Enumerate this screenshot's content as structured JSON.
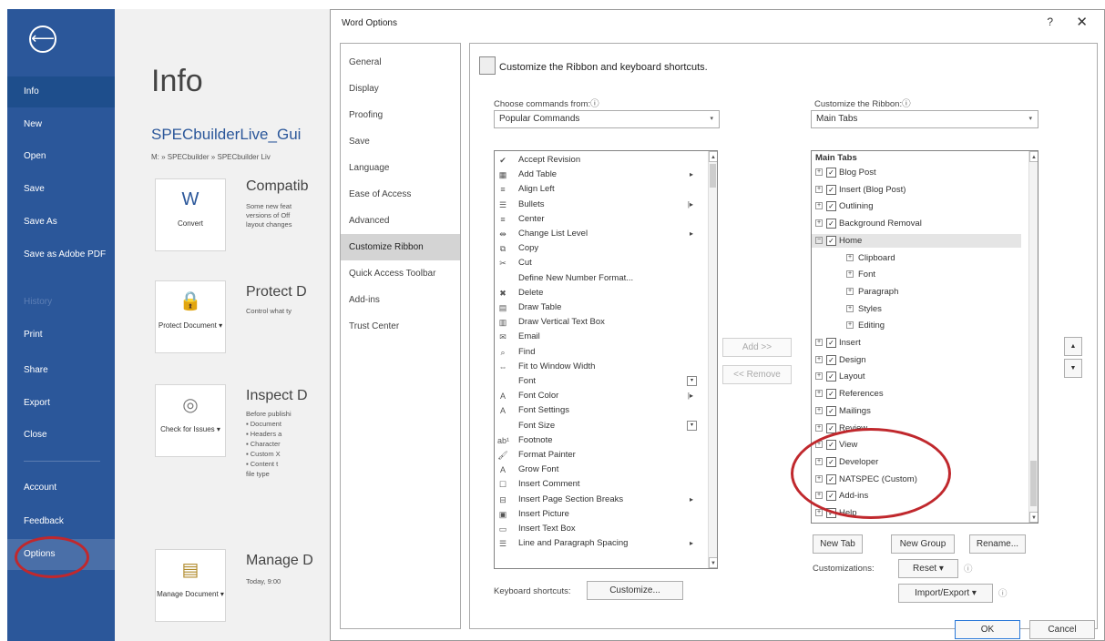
{
  "nav": {
    "back": "⟵",
    "items": [
      {
        "label": "Info"
      },
      {
        "label": "New"
      },
      {
        "label": "Open"
      },
      {
        "label": "Save"
      },
      {
        "label": "Save As"
      },
      {
        "label": "Save as Adobe PDF"
      },
      {
        "label": "History"
      },
      {
        "label": "Print"
      },
      {
        "label": "Share"
      },
      {
        "label": "Export"
      },
      {
        "label": "Close"
      },
      {
        "label": "Account"
      },
      {
        "label": "Feedback"
      },
      {
        "label": "Options"
      }
    ]
  },
  "info": {
    "title": "Info",
    "filename": "SPECbuilderLive_Gui",
    "path": "M: » SPECbuilder » SPECbuilder Liv",
    "sections": [
      {
        "tile": "Convert",
        "title": "Compatib",
        "lines": [
          "Some new feat",
          "versions of Off",
          "layout changes"
        ]
      },
      {
        "tile": "Protect Document ▾",
        "title": "Protect D",
        "lines": [
          "Control what ty"
        ]
      },
      {
        "tile": "Check for Issues ▾",
        "title": "Inspect D",
        "lines": [
          "Before publishi",
          "▪  Document",
          "▪  Headers a",
          "▪  Character",
          "▪  Custom X",
          "▪  Content t",
          "    file type"
        ]
      },
      {
        "tile": "Manage Document ▾",
        "title": "Manage D",
        "lines": [
          "Today, 9:00"
        ]
      }
    ]
  },
  "dialog": {
    "title": "Word Options",
    "help": "?",
    "close": "✕",
    "categories": [
      "General",
      "Display",
      "Proofing",
      "Save",
      "Language",
      "Ease of Access",
      "Advanced",
      "Customize Ribbon",
      "Quick Access Toolbar",
      "Add-ins",
      "Trust Center"
    ],
    "selected_category": "Customize Ribbon",
    "heading": "Customize the Ribbon and keyboard shortcuts.",
    "choose_label": "Choose commands from:ⓘ",
    "choose_value": "Popular Commands",
    "customize_label": "Customize the Ribbon:ⓘ",
    "customize_value": "Main Tabs",
    "commands": [
      {
        "icon": "✔",
        "label": "Accept Revision",
        "sub": ""
      },
      {
        "icon": "▦",
        "label": "Add Table",
        "sub": "▸"
      },
      {
        "icon": "≡",
        "label": "Align Left",
        "sub": ""
      },
      {
        "icon": "☰",
        "label": "Bullets",
        "sub": "|▸"
      },
      {
        "icon": "≡",
        "label": "Center",
        "sub": ""
      },
      {
        "icon": "⇹",
        "label": "Change List Level",
        "sub": "▸"
      },
      {
        "icon": "⧉",
        "label": "Copy",
        "sub": ""
      },
      {
        "icon": "✂",
        "label": "Cut",
        "sub": ""
      },
      {
        "icon": "",
        "label": "Define New Number Format...",
        "sub": ""
      },
      {
        "icon": "✖",
        "label": "Delete",
        "sub": ""
      },
      {
        "icon": "▤",
        "label": "Draw Table",
        "sub": ""
      },
      {
        "icon": "▥",
        "label": "Draw Vertical Text Box",
        "sub": ""
      },
      {
        "icon": "✉",
        "label": "Email",
        "sub": ""
      },
      {
        "icon": "⌕",
        "label": "Find",
        "sub": ""
      },
      {
        "icon": "⇔",
        "label": "Fit to Window Width",
        "sub": ""
      },
      {
        "icon": "",
        "label": "Font",
        "sub": "box"
      },
      {
        "icon": "A",
        "label": "Font Color",
        "sub": "|▸"
      },
      {
        "icon": "A",
        "label": "Font Settings",
        "sub": ""
      },
      {
        "icon": "",
        "label": "Font Size",
        "sub": "box"
      },
      {
        "icon": "ab¹",
        "label": "Footnote",
        "sub": ""
      },
      {
        "icon": "🖌",
        "label": "Format Painter",
        "sub": ""
      },
      {
        "icon": "A",
        "label": "Grow Font",
        "sub": ""
      },
      {
        "icon": "☐",
        "label": "Insert Comment",
        "sub": ""
      },
      {
        "icon": "⊟",
        "label": "Insert Page  Section Breaks",
        "sub": "▸"
      },
      {
        "icon": "▣",
        "label": "Insert Picture",
        "sub": ""
      },
      {
        "icon": "▭",
        "label": "Insert Text Box",
        "sub": ""
      },
      {
        "icon": "☰",
        "label": "Line and Paragraph Spacing",
        "sub": "▸"
      }
    ],
    "tabs_header": "Main Tabs",
    "tabs": [
      {
        "label": "Blog Post",
        "level": 0,
        "exp": "⊞",
        "chk": true
      },
      {
        "label": "Insert (Blog Post)",
        "level": 0,
        "exp": "⊞",
        "chk": true
      },
      {
        "label": "Outlining",
        "level": 0,
        "exp": "⊞",
        "chk": true
      },
      {
        "label": "Background Removal",
        "level": 0,
        "exp": "⊞",
        "chk": true
      },
      {
        "label": "Home",
        "level": 0,
        "exp": "⊟",
        "chk": true
      },
      {
        "label": "Clipboard",
        "level": 1,
        "exp": "⊞",
        "chk": false
      },
      {
        "label": "Font",
        "level": 1,
        "exp": "⊞",
        "chk": false
      },
      {
        "label": "Paragraph",
        "level": 1,
        "exp": "⊞",
        "chk": false
      },
      {
        "label": "Styles",
        "level": 1,
        "exp": "⊞",
        "chk": false
      },
      {
        "label": "Editing",
        "level": 1,
        "exp": "⊞",
        "chk": false
      },
      {
        "label": "Insert",
        "level": 0,
        "exp": "⊞",
        "chk": true
      },
      {
        "label": "Design",
        "level": 0,
        "exp": "⊞",
        "chk": true
      },
      {
        "label": "Layout",
        "level": 0,
        "exp": "⊞",
        "chk": true
      },
      {
        "label": "References",
        "level": 0,
        "exp": "⊞",
        "chk": true
      },
      {
        "label": "Mailings",
        "level": 0,
        "exp": "⊞",
        "chk": true
      },
      {
        "label": "Review",
        "level": 0,
        "exp": "⊞",
        "chk": true
      },
      {
        "label": "View",
        "level": 0,
        "exp": "⊞",
        "chk": true
      },
      {
        "label": "Developer",
        "level": 0,
        "exp": "⊞",
        "chk": true
      },
      {
        "label": "NATSPEC (Custom)",
        "level": 0,
        "exp": "⊞",
        "chk": true
      },
      {
        "label": "Add-ins",
        "level": 0,
        "exp": "⊞",
        "chk": true
      },
      {
        "label": "Help",
        "level": 0,
        "exp": "⊞",
        "chk": true
      }
    ],
    "add_btn": "Add >>",
    "remove_btn": "<< Remove",
    "up_arrow": "▲",
    "down_arrow": "▼",
    "new_tab": "New Tab",
    "new_group": "New Group",
    "rename": "Rename...",
    "customizations_label": "Customizations:",
    "reset": "Reset ▾",
    "import_export": "Import/Export ▾",
    "info_icon": "ⓘ",
    "keyboard_label": "Keyboard shortcuts:",
    "customize_btn": "Customize...",
    "ok": "OK",
    "cancel": "Cancel"
  },
  "colors": {
    "nav_bg": "#2b579a",
    "highlight_ellipse": "#c0282d"
  }
}
